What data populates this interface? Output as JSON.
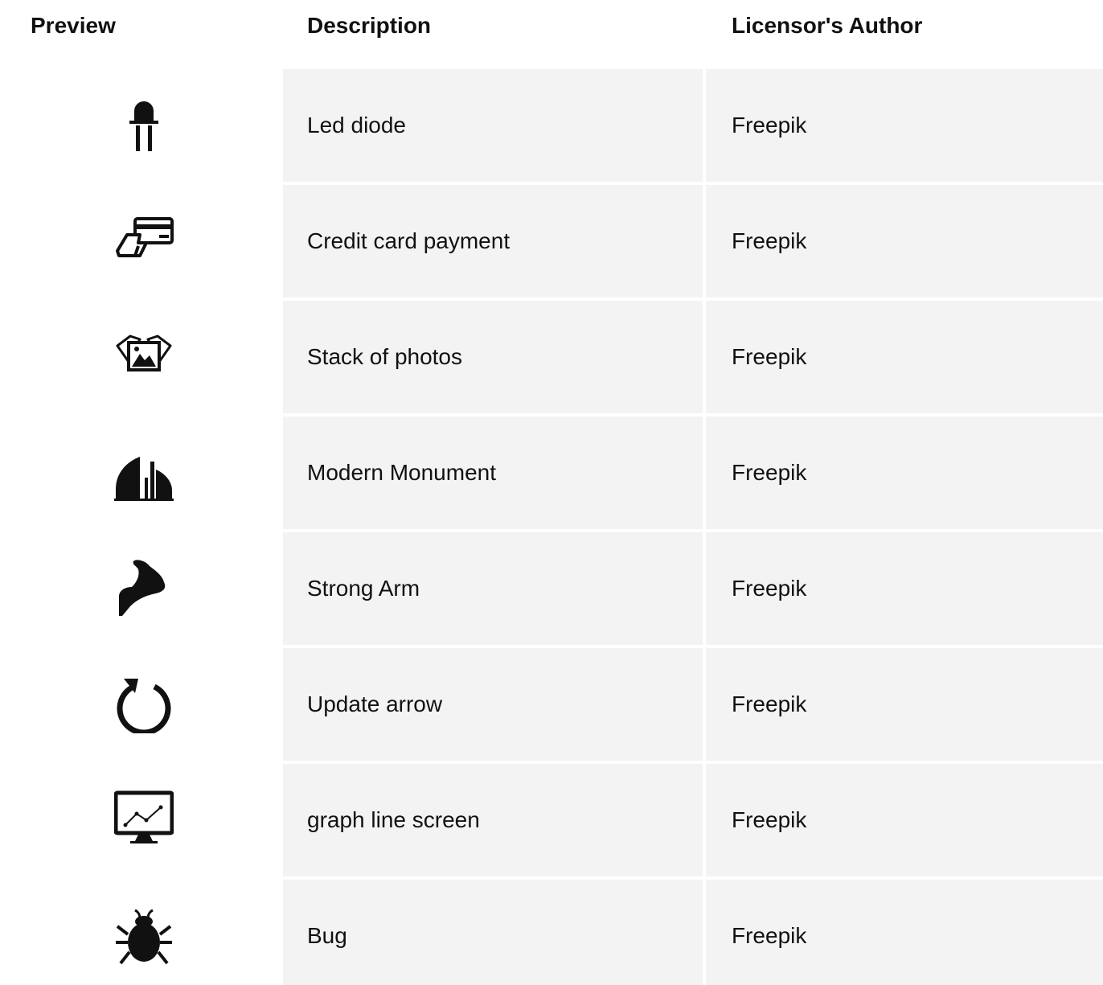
{
  "table": {
    "headers": {
      "preview": "Preview",
      "description": "Description",
      "author": "Licensor's Author"
    },
    "rows": [
      {
        "icon": "led-diode-icon",
        "description": "Led diode",
        "author": "Freepik"
      },
      {
        "icon": "credit-card-payment-icon",
        "description": "Credit card payment",
        "author": "Freepik"
      },
      {
        "icon": "stack-of-photos-icon",
        "description": "Stack of photos",
        "author": "Freepik"
      },
      {
        "icon": "modern-monument-icon",
        "description": "Modern Monument",
        "author": "Freepik"
      },
      {
        "icon": "strong-arm-icon",
        "description": "Strong Arm",
        "author": "Freepik"
      },
      {
        "icon": "update-arrow-icon",
        "description": "Update arrow",
        "author": "Freepik"
      },
      {
        "icon": "graph-line-screen-icon",
        "description": "graph line screen",
        "author": "Freepik"
      },
      {
        "icon": "bug-icon",
        "description": "Bug",
        "author": "Freepik"
      }
    ]
  },
  "colors": {
    "cell_background": "#f3f3f3",
    "text": "#111111"
  }
}
